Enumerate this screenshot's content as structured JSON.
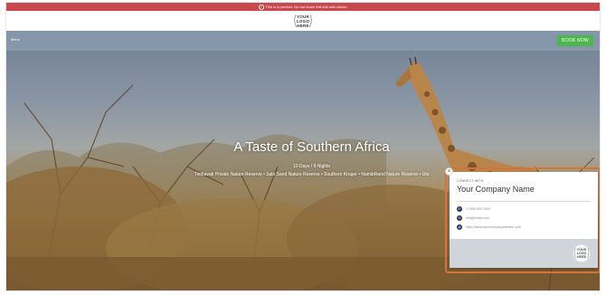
{
  "preview_banner": {
    "text": "This is a preview. Do not share this link with clients.",
    "icon": "info-icon"
  },
  "logo": {
    "line1": "YOUR",
    "line2": "LOGO",
    "line3": "HERE"
  },
  "nav": {
    "menu_label": "Menu",
    "book_button": "BOOK NOW",
    "book_color": "#4cb74c"
  },
  "hero": {
    "title": "A Taste of Southern Africa",
    "duration": "10 Days / 9 Nights",
    "route": "Timbavati Private Nature Reserve  •  Sabi Sand Nature Reserve  •  Southern Kruger  •  NamibRand Nature Reserve  •  Ula"
  },
  "contact_card": {
    "close_icon": "×",
    "connect_label": "CONNECT WITH",
    "company_name": "Your Company Name",
    "phone": "+1 555 000 1000",
    "email": "info@email.com",
    "website": "https://www.yourcompanywebsite.com",
    "highlight_color": "#d3743d",
    "icons": [
      "phone-icon",
      "email-icon",
      "globe-icon"
    ],
    "logo": {
      "line1": "YOUR",
      "line2": "LOGO",
      "line3": "HERE"
    }
  }
}
